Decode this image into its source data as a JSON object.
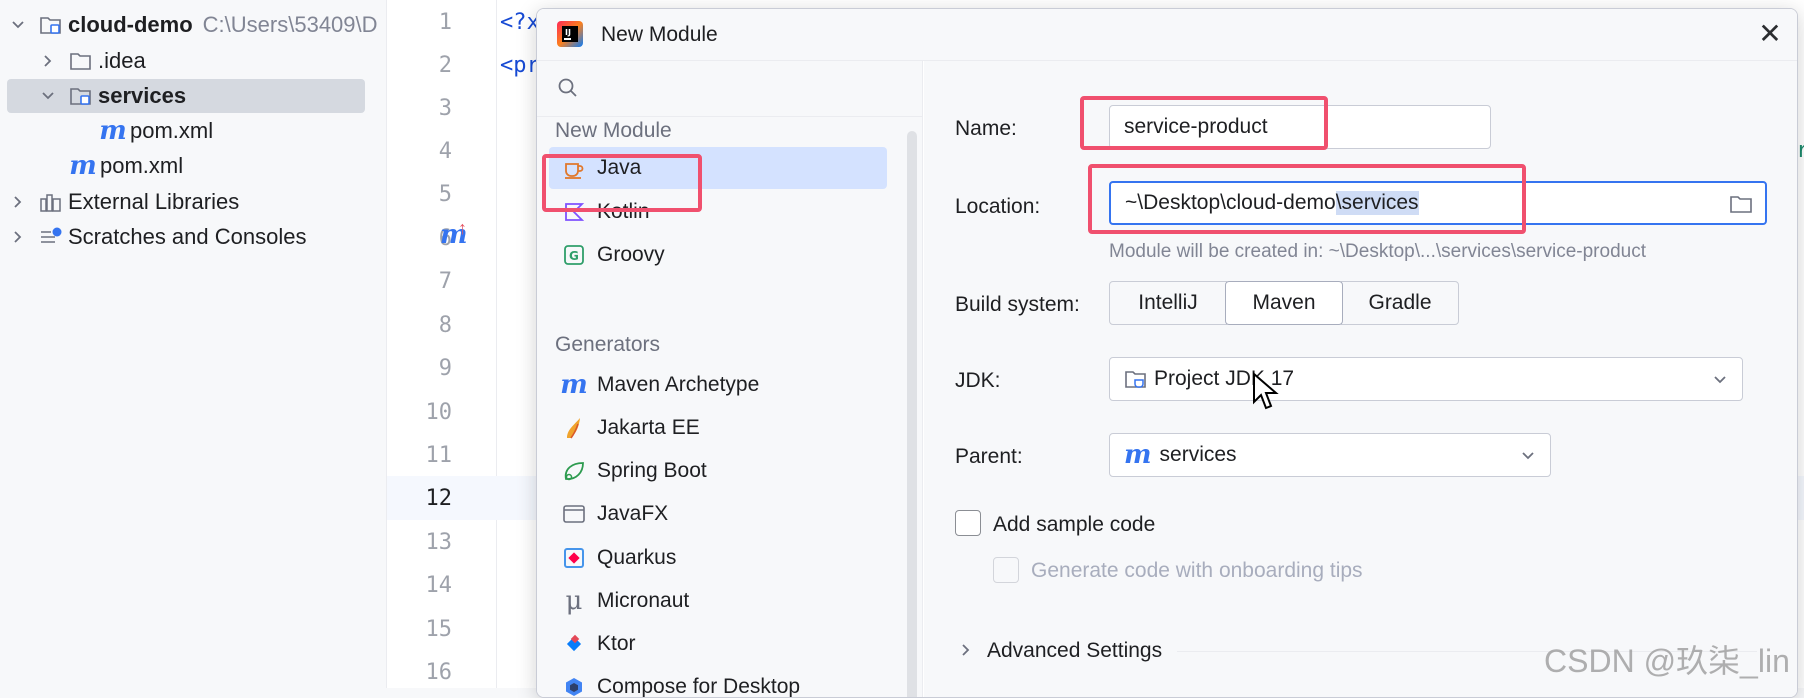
{
  "project_tree": {
    "root_name": "cloud-demo",
    "root_path": "C:\\Users\\53409\\D",
    "idea": ".idea",
    "services": "services",
    "services_pom": "pom.xml",
    "root_pom": "pom.xml",
    "external_libraries": "External Libraries",
    "scratches": "Scratches and Consoles"
  },
  "editor": {
    "line_numbers": [
      "1",
      "2",
      "3",
      "4",
      "5",
      "6",
      "7",
      "8",
      "9",
      "10",
      "11",
      "12",
      "13",
      "14",
      "15",
      "16"
    ],
    "current_line": "12",
    "code_line_1": "<?x",
    "code_line_2": "<pr",
    "gutter_marker": "m",
    "edge_char": "r"
  },
  "dialog": {
    "title": "New Module",
    "close_glyph": "✕",
    "left": {
      "group_new_module": "New Module",
      "items_new_module": [
        {
          "label": "Java",
          "icon": "java-icon"
        },
        {
          "label": "Kotlin",
          "icon": "kotlin-icon"
        },
        {
          "label": "Groovy",
          "icon": "groovy-icon"
        }
      ],
      "group_generators": "Generators",
      "items_generators": [
        {
          "label": "Maven Archetype",
          "icon": "maven-icon"
        },
        {
          "label": "Jakarta EE",
          "icon": "jakarta-icon"
        },
        {
          "label": "Spring Boot",
          "icon": "spring-icon"
        },
        {
          "label": "JavaFX",
          "icon": "javafx-icon"
        },
        {
          "label": "Quarkus",
          "icon": "quarkus-icon"
        },
        {
          "label": "Micronaut",
          "icon": "micronaut-icon"
        },
        {
          "label": "Ktor",
          "icon": "ktor-icon"
        },
        {
          "label": "Compose for Desktop",
          "icon": "compose-icon"
        }
      ]
    },
    "form": {
      "name_label": "Name:",
      "name_value": "service-product",
      "location_label": "Location:",
      "location_prefix": "~\\Desktop\\cloud-demo",
      "location_selected": "\\services",
      "location_hint": "Module will be created in: ~\\Desktop\\...\\services\\service-product",
      "build_system_label": "Build system:",
      "build_options": [
        "IntelliJ",
        "Maven",
        "Gradle"
      ],
      "build_selected": "Maven",
      "jdk_label": "JDK:",
      "jdk_value": "Project JDK 17",
      "parent_label": "Parent:",
      "parent_value": "services",
      "add_sample_code": "Add sample code",
      "add_sample_code_checked": false,
      "onboarding_tips": "Generate code with onboarding tips",
      "onboarding_tips_checked": false,
      "advanced_settings": "Advanced Settings"
    }
  },
  "watermark": "CSDN @玖柒_lin",
  "colors": {
    "accent": "#3574f0",
    "selection": "#d4e2ff",
    "annotation_red": "#f0506e"
  }
}
